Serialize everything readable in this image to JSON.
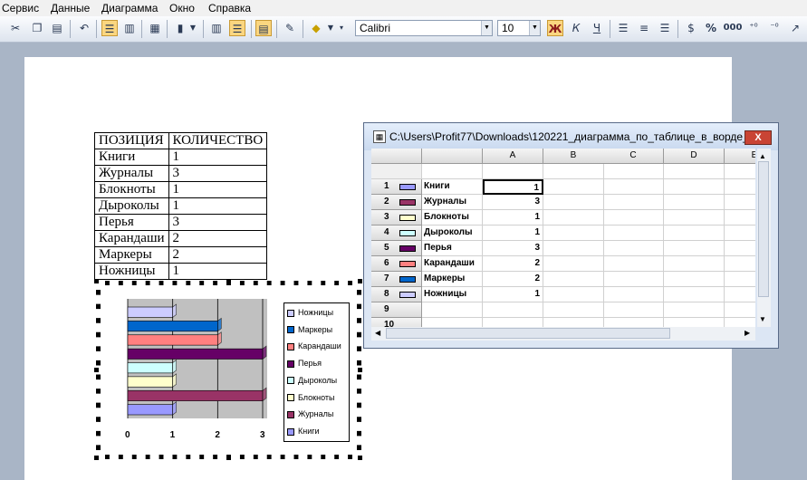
{
  "menu": [
    "Сервис",
    "Данные",
    "Диаграмма",
    "Окно",
    "Справка"
  ],
  "toolbar": {
    "font_name": "Calibri",
    "font_size": "10",
    "bold_label": "Ж",
    "italic_label": "К",
    "underline_label": "Ч",
    "percent_label": "%",
    "thousands_label": "000"
  },
  "doc_table": {
    "headers": [
      "ПОЗИЦИЯ",
      "КОЛИЧЕСТВО"
    ],
    "rows": [
      [
        "Книги",
        "1"
      ],
      [
        "Журналы",
        "3"
      ],
      [
        "Блокноты",
        "1"
      ],
      [
        "Дыроколы",
        "1"
      ],
      [
        "Перья",
        "3"
      ],
      [
        "Карандаши",
        "2"
      ],
      [
        "Маркеры",
        "2"
      ],
      [
        "Ножницы",
        "1"
      ]
    ]
  },
  "chart_data": {
    "type": "bar",
    "orientation": "horizontal",
    "categories": [
      "Книги",
      "Журналы",
      "Блокноты",
      "Дыроколы",
      "Перья",
      "Карандаши",
      "Маркеры",
      "Ножницы"
    ],
    "values": [
      1,
      3,
      1,
      1,
      3,
      2,
      2,
      1
    ],
    "colors": [
      "#9999ff",
      "#993366",
      "#ffffcc",
      "#ccffff",
      "#660066",
      "#ff8080",
      "#0066cc",
      "#ccccff"
    ],
    "xlim": [
      0,
      3
    ],
    "xticks": [
      "0",
      "1",
      "2",
      "3"
    ],
    "legend": "right",
    "grid": true
  },
  "datasheet": {
    "title": "C:\\Users\\Profit77\\Downloads\\120221_диаграмма_по_таблице_в_ворде_...",
    "close_label": "X",
    "columns": [
      "A",
      "B",
      "C",
      "D",
      "E"
    ],
    "rows": [
      {
        "num": "1",
        "label": "Книги",
        "value": "1"
      },
      {
        "num": "2",
        "label": "Журналы",
        "value": "3"
      },
      {
        "num": "3",
        "label": "Блокноты",
        "value": "1"
      },
      {
        "num": "4",
        "label": "Дыроколы",
        "value": "1"
      },
      {
        "num": "5",
        "label": "Перья",
        "value": "3"
      },
      {
        "num": "6",
        "label": "Карандаши",
        "value": "2"
      },
      {
        "num": "7",
        "label": "Маркеры",
        "value": "2"
      },
      {
        "num": "8",
        "label": "Ножницы",
        "value": "1"
      },
      {
        "num": "9",
        "label": "",
        "value": ""
      },
      {
        "num": "10",
        "label": "",
        "value": ""
      }
    ]
  }
}
